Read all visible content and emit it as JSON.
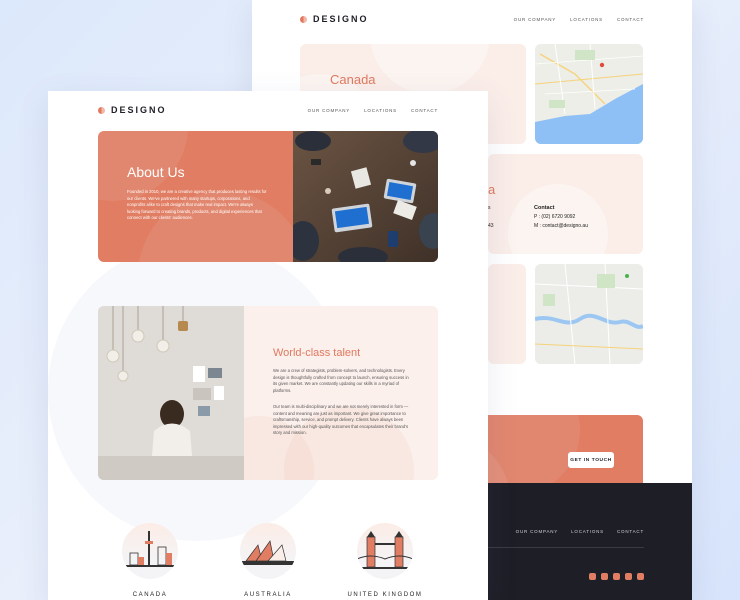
{
  "brand": {
    "name": "DESIGNO"
  },
  "nav": {
    "items": [
      "OUR COMPANY",
      "LOCATIONS",
      "CONTACT"
    ]
  },
  "locations_page": {
    "canada_title": "Canada",
    "partial_title": "a",
    "contact": {
      "heading": "Contact",
      "phone": "P : (02) 6720 9092",
      "email": "M : contact@designo.au",
      "left_fragment_1": "s",
      "left_fragment_2": "43"
    },
    "cta_button": "GET IN TOUCH",
    "footer_nav": [
      "OUR COMPANY",
      "LOCATIONS",
      "CONTACT"
    ],
    "social_icons": [
      "facebook-icon",
      "youtube-icon",
      "twitter-icon",
      "pinterest-icon",
      "instagram-icon"
    ]
  },
  "about_page": {
    "hero": {
      "title": "About Us",
      "body": "Founded in 2010, we are a creative agency that produces lasting results for our clients. We've partnered with many startups, corporations, and nonprofits alike to craft designs that make real impact. We're always looking forward to creating brands, products, and digital experiences that connect with our clients' audiences."
    },
    "talent": {
      "title": "World-class talent",
      "para1": "We are a crew of strategists, problem-solvers, and technologists. Every design is thoughtfully crafted from concept to launch, ensuring success in its given market. We are constantly updating our skills in a myriad of platforms.",
      "para2": "Our team is multi-disciplinary and we are not merely interested in form — content and meaning are just as important. We give great importance to craftsmanship, service, and prompt delivery. Clients have always been impressed with our high-quality outcomes that encapsulates their brand's story and mission."
    },
    "locations": [
      "CANADA",
      "AUSTRALIA",
      "UNITED KINGDOM"
    ]
  },
  "colors": {
    "peach": "#e07d63",
    "light_peach": "#fbeee9",
    "dark": "#1e1e26"
  }
}
